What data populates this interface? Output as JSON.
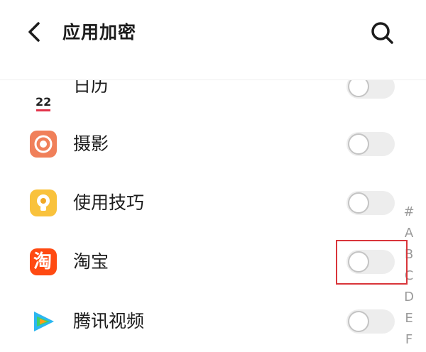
{
  "header": {
    "title": "应用加密",
    "back_icon": "chevron-left-icon",
    "search_icon": "search-icon"
  },
  "apps": [
    {
      "label": "日历",
      "icon": "calendar-icon",
      "icon_text": "22",
      "enabled": false
    },
    {
      "label": "摄影",
      "icon": "camera-icon",
      "enabled": false
    },
    {
      "label": "使用技巧",
      "icon": "tips-bulb-icon",
      "enabled": false
    },
    {
      "label": "淘宝",
      "icon": "taobao-icon",
      "icon_text": "淘",
      "enabled": false,
      "highlighted": true
    },
    {
      "label": "腾讯视频",
      "icon": "tencent-video-icon",
      "enabled": false
    }
  ],
  "index_bar": [
    "#",
    "A",
    "B",
    "C",
    "D",
    "E",
    "F"
  ],
  "colors": {
    "highlight": "#d9353a",
    "camera": "#f0805a",
    "tips": "#f9c23c",
    "taobao": "#ff4a12",
    "toggle_off": "#ededed"
  }
}
